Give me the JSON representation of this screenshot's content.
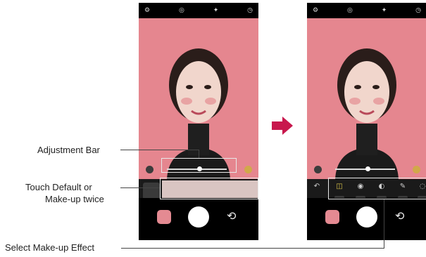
{
  "callouts": {
    "adjustment_bar": "Adjustment Bar",
    "touch_default_line1": "Touch Default or",
    "touch_default_line2": "Make-up twice",
    "select_makeup": "Select Make-up Effect"
  },
  "icons": {
    "settings": "⚙",
    "filter": "◎",
    "light": "✦",
    "timer": "◷",
    "flip": "⟲",
    "back": "↶",
    "arrow": "arrow-right-icon"
  },
  "colors": {
    "preview_bg": "#e5868f",
    "arrow": "#c8174d"
  }
}
